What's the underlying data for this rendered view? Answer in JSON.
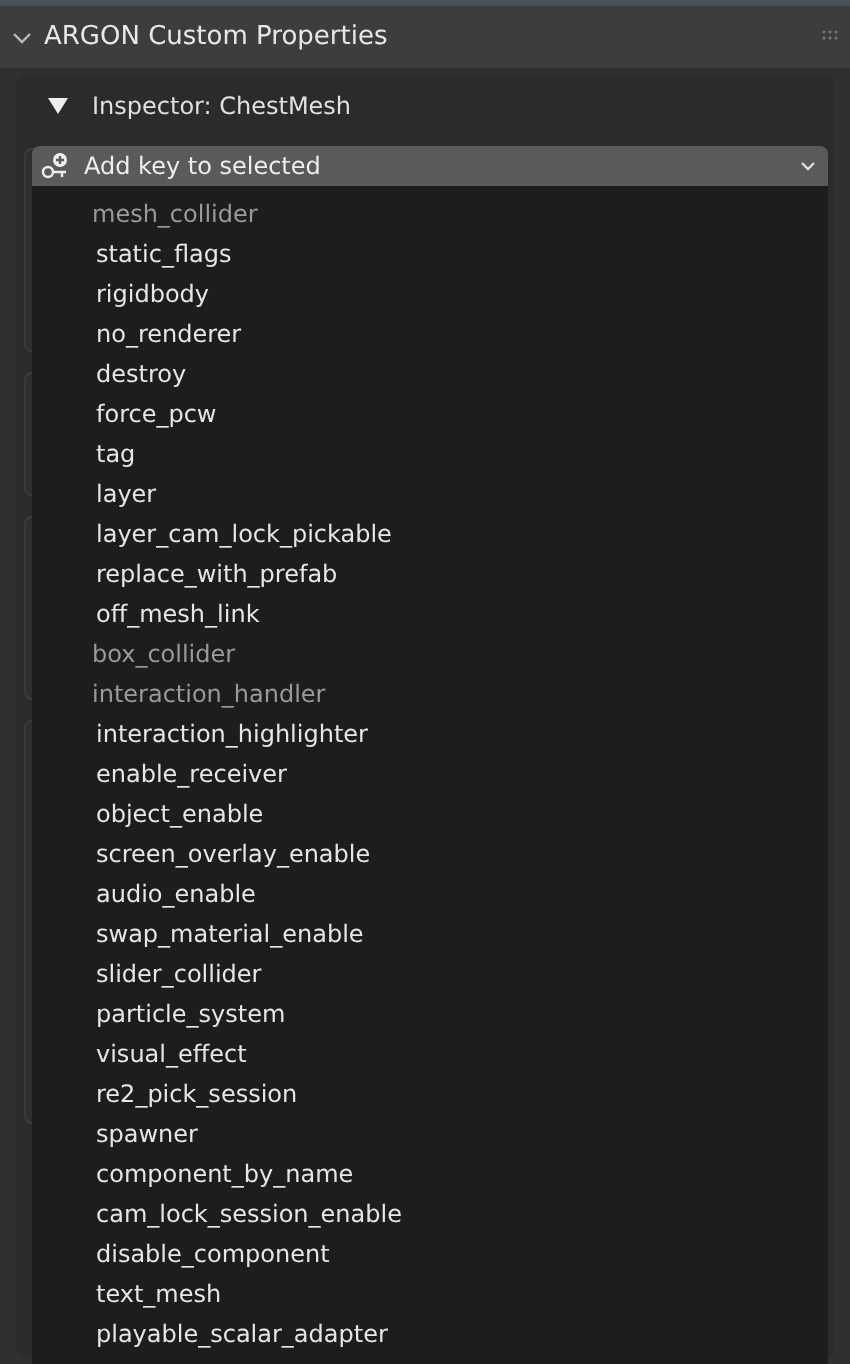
{
  "panel": {
    "title": "ARGON Custom Properties",
    "expanded": true
  },
  "inspector": {
    "title": "Inspector: ChestMesh",
    "expanded": true
  },
  "dropdown": {
    "label": "Add key to selected",
    "open": true
  },
  "menu_items": [
    {
      "label": "mesh_collider",
      "disabled": true
    },
    {
      "label": "static_flags",
      "disabled": false
    },
    {
      "label": "rigidbody",
      "disabled": false
    },
    {
      "label": "no_renderer",
      "disabled": false
    },
    {
      "label": "destroy",
      "disabled": false
    },
    {
      "label": "force_pcw",
      "disabled": false
    },
    {
      "label": "tag",
      "disabled": false
    },
    {
      "label": "layer",
      "disabled": false
    },
    {
      "label": "layer_cam_lock_pickable",
      "disabled": false
    },
    {
      "label": "replace_with_prefab",
      "disabled": false
    },
    {
      "label": "off_mesh_link",
      "disabled": false
    },
    {
      "label": "box_collider",
      "disabled": true
    },
    {
      "label": "interaction_handler",
      "disabled": true
    },
    {
      "label": "interaction_highlighter",
      "disabled": false
    },
    {
      "label": "enable_receiver",
      "disabled": false
    },
    {
      "label": "object_enable",
      "disabled": false
    },
    {
      "label": "screen_overlay_enable",
      "disabled": false
    },
    {
      "label": "audio_enable",
      "disabled": false
    },
    {
      "label": "swap_material_enable",
      "disabled": false
    },
    {
      "label": "slider_collider",
      "disabled": false
    },
    {
      "label": "particle_system",
      "disabled": false
    },
    {
      "label": "visual_effect",
      "disabled": false
    },
    {
      "label": "re2_pick_session",
      "disabled": false
    },
    {
      "label": "spawner",
      "disabled": false
    },
    {
      "label": "component_by_name",
      "disabled": false
    },
    {
      "label": "cam_lock_session_enable",
      "disabled": false
    },
    {
      "label": "disable_component",
      "disabled": false
    },
    {
      "label": "text_mesh",
      "disabled": false
    },
    {
      "label": "playable_scalar_adapter",
      "disabled": false
    }
  ]
}
